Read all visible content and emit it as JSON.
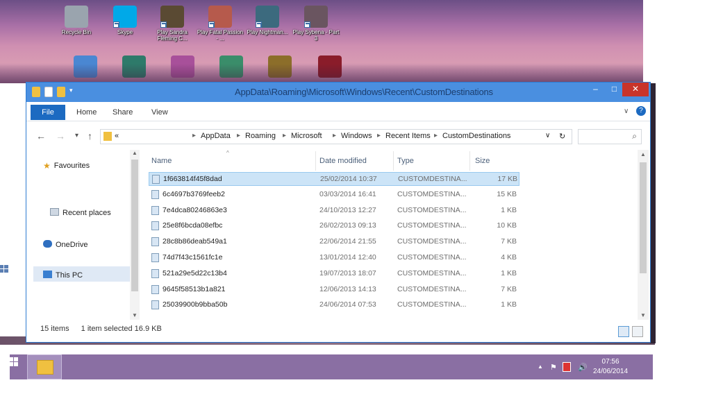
{
  "desktop": {
    "icons_top": [
      {
        "label": "Recycle Bin",
        "color": "#9aa4ae"
      },
      {
        "label": "Skype",
        "color": "#00a9e8"
      },
      {
        "label": "Play Sandra Fleming C...",
        "color": "#5a4a33"
      },
      {
        "label": "Play Fatal Passion - ...",
        "color": "#b65a4c"
      },
      {
        "label": "Play Nightman...",
        "color": "#3c6a7e"
      },
      {
        "label": "Play Sybena - Part 3",
        "color": "#6a5560"
      }
    ],
    "icons_bottom_colors": [
      "#4a87d2",
      "#2e7a6a",
      "#a8509a",
      "#3a8d6a",
      "#8c6e2a",
      "#8a1c2a"
    ]
  },
  "window": {
    "title": "AppData\\Roaming\\Microsoft\\Windows\\Recent\\CustomDestinations",
    "controls": {
      "minimize": "–",
      "maximize": "□",
      "close": "✕"
    },
    "ribbon_tabs": [
      "File",
      "Home",
      "Share",
      "View"
    ],
    "help": "?",
    "address": {
      "prefix": "«",
      "crumbs": [
        "AppData",
        "Roaming",
        "Microsoft",
        "Windows",
        "Recent Items",
        "CustomDestinations"
      ],
      "separator": "▸",
      "dropdown": "∨",
      "refresh": "↻",
      "search_icon": "⌕"
    },
    "nav_buttons": {
      "back": "←",
      "forward": "→",
      "down": "▾",
      "up": "↑"
    },
    "nav_pane": {
      "items": [
        "Favourites",
        "Recent places",
        "OneDrive",
        "This PC"
      ],
      "selected": "This PC"
    },
    "columns": {
      "name": "Name",
      "date": "Date modified",
      "type": "Type",
      "size": "Size"
    },
    "files": [
      {
        "name": "1f663814f45f8dad",
        "date": "25/02/2014 10:37",
        "type": "CUSTOMDESTINA...",
        "size": "17 KB",
        "selected": true
      },
      {
        "name": "6c4697b3769feeb2",
        "date": "03/03/2014 16:41",
        "type": "CUSTOMDESTINA...",
        "size": "15 KB",
        "selected": false
      },
      {
        "name": "7e4dca80246863e3",
        "date": "24/10/2013 12:27",
        "type": "CUSTOMDESTINA...",
        "size": "1 KB",
        "selected": false
      },
      {
        "name": "25e8f6bcda08efbc",
        "date": "26/02/2013 09:13",
        "type": "CUSTOMDESTINA...",
        "size": "10 KB",
        "selected": false
      },
      {
        "name": "28c8b86deab549a1",
        "date": "22/06/2014 21:55",
        "type": "CUSTOMDESTINA...",
        "size": "7 KB",
        "selected": false
      },
      {
        "name": "74d7f43c1561fc1e",
        "date": "13/01/2014 12:40",
        "type": "CUSTOMDESTINA...",
        "size": "4 KB",
        "selected": false
      },
      {
        "name": "521a29e5d22c13b4",
        "date": "19/07/2013 18:07",
        "type": "CUSTOMDESTINA...",
        "size": "1 KB",
        "selected": false
      },
      {
        "name": "9645f58513b1a821",
        "date": "12/06/2013 14:13",
        "type": "CUSTOMDESTINA...",
        "size": "7 KB",
        "selected": false
      },
      {
        "name": "25039900b9bba50b",
        "date": "24/06/2014 07:53",
        "type": "CUSTOMDESTINA...",
        "size": "1 KB",
        "selected": false
      }
    ],
    "status": {
      "items": "15 items",
      "selection": "1 item selected 16.9 KB"
    }
  },
  "taskbar": {
    "time": "07:56",
    "date": "24/06/2014",
    "tray": [
      "▲",
      "⚑",
      "🔊"
    ]
  }
}
